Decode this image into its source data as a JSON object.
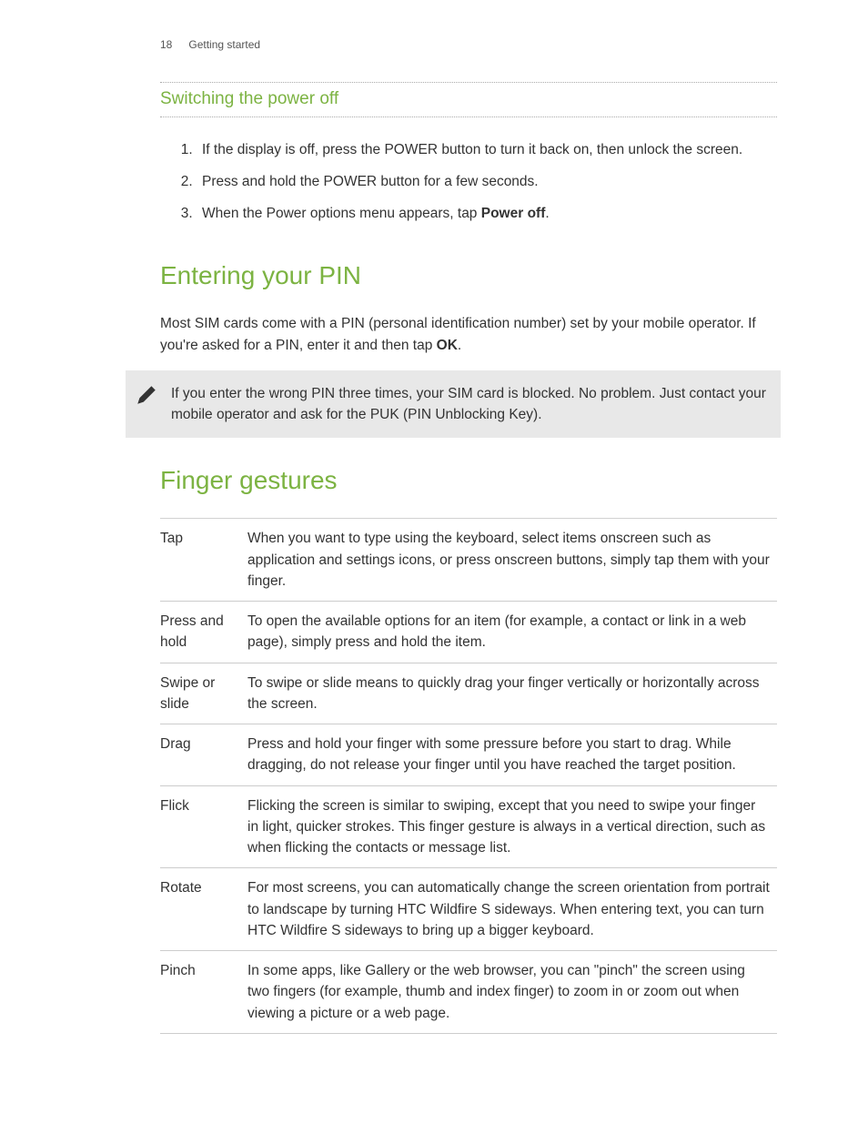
{
  "header": {
    "page_number": "18",
    "chapter": "Getting started"
  },
  "section_power_off": {
    "heading": "Switching the power off",
    "steps": [
      {
        "n": "1.",
        "text_pre": "If the display is off, press the POWER button to turn it back on, then unlock the screen."
      },
      {
        "n": "2.",
        "text_pre": "Press and hold the POWER button for a few seconds."
      },
      {
        "n": "3.",
        "text_pre": "When the Power options menu appears, tap ",
        "bold": "Power off",
        "text_post": "."
      }
    ]
  },
  "section_pin": {
    "heading": "Entering your PIN",
    "paragraph_pre": "Most SIM cards come with a PIN (personal identification number) set by your mobile operator. If you're asked for a PIN, enter it and then tap ",
    "paragraph_bold": "OK",
    "paragraph_post": ".",
    "note": "If you enter the wrong PIN three times, your SIM card is blocked. No problem. Just contact your mobile operator and ask for the PUK (PIN Unblocking Key)."
  },
  "section_gestures": {
    "heading": "Finger gestures",
    "rows": [
      {
        "term": "Tap",
        "desc": "When you want to type using the keyboard, select items onscreen such as application and settings icons, or press onscreen buttons, simply tap them with your finger."
      },
      {
        "term": "Press and hold",
        "desc": "To open the available options for an item (for example, a contact or link in a web page), simply press and hold the item."
      },
      {
        "term": "Swipe or slide",
        "desc": "To swipe or slide means to quickly drag your finger vertically or horizontally across the screen."
      },
      {
        "term": "Drag",
        "desc": "Press and hold your finger with some pressure before you start to drag. While dragging, do not release your finger until you have reached the target position."
      },
      {
        "term": "Flick",
        "desc": "Flicking the screen is similar to swiping, except that you need to swipe your finger in light, quicker strokes. This finger gesture is always in a vertical direction, such as when flicking the contacts or message list."
      },
      {
        "term": "Rotate",
        "desc": "For most screens, you can automatically change the screen orientation from portrait to landscape by turning HTC Wildfire S sideways. When entering text, you can turn HTC Wildfire S sideways to bring up a bigger keyboard."
      },
      {
        "term": "Pinch",
        "desc": "In some apps, like Gallery or the web browser, you can \"pinch\" the screen using two fingers (for example, thumb and index finger) to zoom in or zoom out when viewing a picture or a web page."
      }
    ]
  }
}
